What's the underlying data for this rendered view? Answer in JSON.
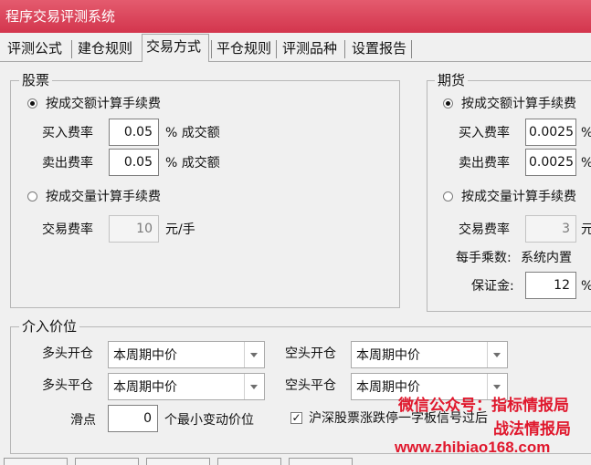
{
  "window": {
    "title": "程序交易评测系统"
  },
  "tabs": [
    {
      "label": "评测公式"
    },
    {
      "label": "建仓规则"
    },
    {
      "label": "交易方式"
    },
    {
      "label": "平仓规则"
    },
    {
      "label": "评测品种"
    },
    {
      "label": "设置报告"
    }
  ],
  "active_tab": "交易方式",
  "stock": {
    "title": "股票",
    "by_amount": {
      "label": "按成交额计算手续费",
      "selected": true
    },
    "buy_rate": {
      "label": "买入费率",
      "value": "0.05",
      "unit": "% 成交额"
    },
    "sell_rate": {
      "label": "卖出费率",
      "value": "0.05",
      "unit": "% 成交额"
    },
    "by_volume": {
      "label": "按成交量计算手续费",
      "selected": false
    },
    "trade_rate": {
      "label": "交易费率",
      "value": "10",
      "unit": "元/手"
    }
  },
  "futures": {
    "title": "期货",
    "by_amount": {
      "label": "按成交额计算手续费",
      "selected": true
    },
    "buy_rate": {
      "label": "买入费率",
      "value": "0.0025",
      "unit": "%"
    },
    "sell_rate": {
      "label": "卖出费率",
      "value": "0.0025",
      "unit": "%"
    },
    "by_volume": {
      "label": "按成交量计算手续费",
      "selected": false
    },
    "trade_rate": {
      "label": "交易费率",
      "value": "3",
      "unit": "元"
    },
    "multiplier": {
      "label": "每手乘数:",
      "value": "系统内置"
    },
    "margin": {
      "label": "保证金:",
      "value": "12",
      "unit": "%"
    }
  },
  "entry_price": {
    "title": "介入价位",
    "long_open": {
      "label": "多头开仓",
      "value": "本周期中价"
    },
    "long_close": {
      "label": "多头平仓",
      "value": "本周期中价"
    },
    "short_open": {
      "label": "空头开仓",
      "value": "本周期中价"
    },
    "short_close": {
      "label": "空头平仓",
      "value": "本周期中价"
    },
    "slippage": {
      "label": "滑点",
      "value": "0",
      "unit": "个最小变动价位"
    },
    "limit_check": {
      "label": "沪深股票涨跌停一字板信号过后",
      "checked": true,
      "mark": "✓"
    }
  },
  "watermark": {
    "line1": "微信公众号：指标情报局",
    "line2": "战法情报局",
    "url": "www.zhibiao168.com",
    "color": "#e0182d"
  }
}
